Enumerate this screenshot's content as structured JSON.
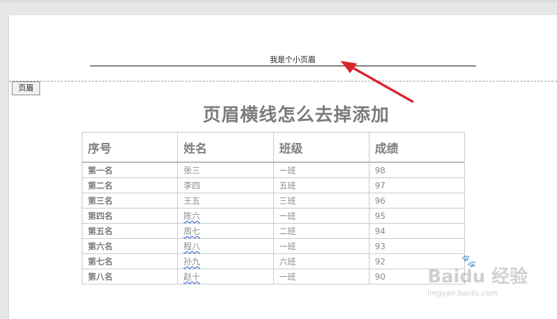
{
  "header": {
    "text": "我是个小页眉",
    "tab_label": "页眉"
  },
  "document": {
    "title": "页眉横线怎么去掉添加"
  },
  "table": {
    "columns": [
      "序号",
      "姓名",
      "班级",
      "成绩"
    ],
    "rows": [
      [
        "第一名",
        "张三",
        "一班",
        "98"
      ],
      [
        "第二名",
        "李四",
        "五班",
        "97"
      ],
      [
        "第三名",
        "王五",
        "三班",
        "96"
      ],
      [
        "第四名",
        "陈六",
        "一班",
        "95"
      ],
      [
        "第五名",
        "周七",
        "二班",
        "94"
      ],
      [
        "第六名",
        "程八",
        "一班",
        "93"
      ],
      [
        "第七名",
        "孙九",
        "六班",
        "92"
      ],
      [
        "第八名",
        "赵十",
        "一班",
        "90"
      ]
    ],
    "spellcheck_underlined_rows": [
      3,
      4,
      5,
      6,
      7
    ]
  },
  "annotation": {
    "arrow_color": "#d9262c"
  },
  "watermark": {
    "logo": "Baidu 经验",
    "url": "jingyan.baidu.com"
  }
}
